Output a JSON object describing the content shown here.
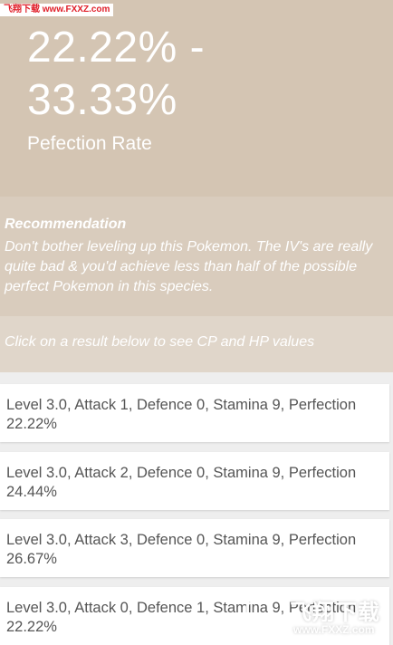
{
  "watermark": {
    "top": "飞翔下载 www.FXXZ.com",
    "bottom_main": "飞翔下载",
    "bottom_url": "www.FXXZ.com"
  },
  "hero": {
    "range_line1": "22.22% -",
    "range_line2": "33.33%",
    "label": "Pefection Rate"
  },
  "recommendation": {
    "title": "Recommendation",
    "body": "Don't bother leveling up this Pokemon. The IV's are really quite bad & you'd achieve less than half of the possible perfect Pokemon in this species."
  },
  "hint": "Click on a result below to see CP and HP values",
  "results": [
    {
      "text": "Level 3.0, Attack 1, Defence 0, Stamina 9, Perfection 22.22%"
    },
    {
      "text": "Level 3.0, Attack 2, Defence 0, Stamina 9, Perfection 24.44%"
    },
    {
      "text": "Level 3.0, Attack 3, Defence 0, Stamina 9, Perfection 26.67%"
    },
    {
      "text": "Level 3.0, Attack 0, Defence 1, Stamina 9, Perfection 22.22%"
    }
  ],
  "colors": {
    "hero_bg": "#d4c5b3",
    "recommend_bg": "#d9ccbd",
    "hint_bg": "#e0d6ca",
    "card_text": "#555555"
  }
}
